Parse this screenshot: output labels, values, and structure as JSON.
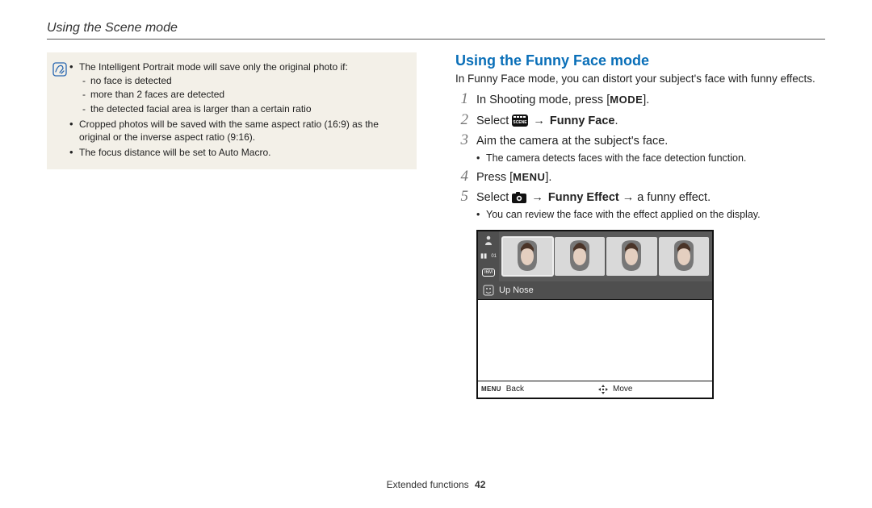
{
  "header": {
    "title": "Using the Scene mode"
  },
  "note": {
    "items": [
      {
        "text": "The Intelligent Portrait mode will save only the original photo if:",
        "sub": [
          "no face is detected",
          "more than 2 faces are detected",
          "the detected facial area is larger than a certain ratio"
        ]
      },
      {
        "text": "Cropped photos will be saved with the same aspect ratio (16:9) as the original or the inverse aspect ratio (9:16)."
      },
      {
        "text": "The focus distance will be set to Auto Macro."
      }
    ]
  },
  "right": {
    "title": "Using the Funny Face mode",
    "intro": "In Funny Face mode, you can distort your subject's face with funny effects.",
    "steps": {
      "s1_a": "In Shooting mode, press [",
      "s1_mode": "MODE",
      "s1_b": "].",
      "s2_a": "Select ",
      "s2_b": " → ",
      "s2_bold": "Funny Face",
      "s2_c": ".",
      "s3": "Aim the camera at the subject's face.",
      "s3_sub": "The camera detects faces with the face detection function.",
      "s4_a": "Press [",
      "s4_menu": "MENU",
      "s4_b": "].",
      "s5_a": "Select ",
      "s5_b": " → ",
      "s5_bold1": "Funny Effect",
      "s5_c": " → a funny effect.",
      "s5_sub": "You can review the face with the effect applied on the display."
    }
  },
  "screenshot": {
    "label": "Up Nose",
    "footer_back": "Back",
    "footer_move": "Move",
    "sidebar_count": "01"
  },
  "footer": {
    "section": "Extended functions",
    "page": "42"
  }
}
